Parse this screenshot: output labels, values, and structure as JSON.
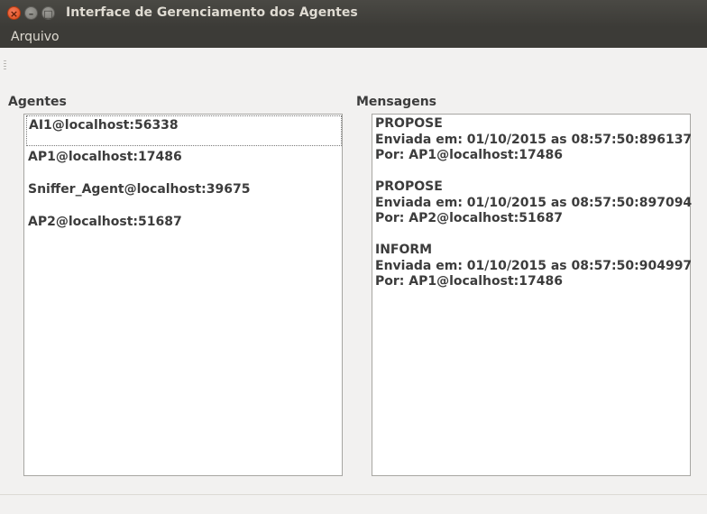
{
  "window": {
    "title": "Interface de Gerenciamento dos Agentes"
  },
  "menu": {
    "items": [
      "Arquivo"
    ]
  },
  "agents": {
    "label": "Agentes",
    "items": [
      "AI1@localhost:56338",
      "AP1@localhost:17486",
      "Sniffer_Agent@localhost:39675",
      "AP2@localhost:51687"
    ],
    "selected_index": 0
  },
  "messages": {
    "label": "Mensagens",
    "items": [
      {
        "type": "PROPOSE",
        "sent": "Enviada em: 01/10/2015 as 08:57:50:896137",
        "by": "Por: AP1@localhost:17486"
      },
      {
        "type": "PROPOSE",
        "sent": "Enviada em: 01/10/2015 as 08:57:50:897094",
        "by": "Por: AP2@localhost:51687"
      },
      {
        "type": "INFORM",
        "sent": "Enviada em: 01/10/2015 as 08:57:50:904997",
        "by": "Por: AP1@localhost:17486"
      }
    ]
  },
  "icons": {
    "close": "close-icon",
    "minimize": "minimize-icon",
    "maximize": "maximize-icon"
  },
  "colors": {
    "titlebar": "#3c3b37",
    "close_button": "#df4a16",
    "window_bg": "#f2f1f0"
  }
}
